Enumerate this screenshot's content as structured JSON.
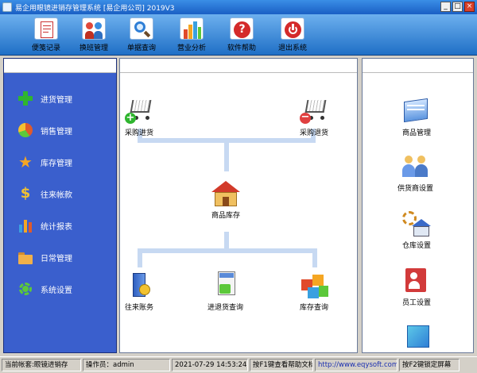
{
  "window": {
    "title": "易企用眼镜进销存管理系统 [易企用公司] 2019V3",
    "controls": [
      "_",
      "□",
      "×"
    ]
  },
  "toolbar": [
    {
      "label": "便笺记录",
      "icon": "notepad-icon"
    },
    {
      "label": "换班管理",
      "icon": "shift-change-icon"
    },
    {
      "label": "单据查询",
      "icon": "search-icon"
    },
    {
      "label": "营业分析",
      "icon": "bar-chart-icon"
    },
    {
      "label": "软件帮助",
      "icon": "help-icon"
    },
    {
      "label": "退出系统",
      "icon": "power-icon"
    }
  ],
  "sidebar": [
    {
      "label": "进货管理",
      "icon": "plus-icon",
      "color": "#2fb52f"
    },
    {
      "label": "销售管理",
      "icon": "pie-chart-icon",
      "color": "#e05a2a"
    },
    {
      "label": "库存管理",
      "icon": "star-icon",
      "color": "#f5a623"
    },
    {
      "label": "往来帐款",
      "icon": "dollar-icon",
      "color": "#f2c230"
    },
    {
      "label": "统计报表",
      "icon": "bar-chart-icon",
      "color": "#f5a623"
    },
    {
      "label": "日常管理",
      "icon": "folder-icon",
      "color": "#e8a040"
    },
    {
      "label": "系统设置",
      "icon": "gear-icon",
      "color": "#5cc83a"
    }
  ],
  "flow": {
    "purchase_in": "采购进货",
    "purchase_return": "采购退货",
    "stock": "商品库存",
    "accounts": "往来账务",
    "io_query": "进退货查询",
    "stock_query": "库存查询"
  },
  "right_panel": [
    {
      "label": "商品管理",
      "icon": "product-icon"
    },
    {
      "label": "供货商设置",
      "icon": "supplier-icon"
    },
    {
      "label": "仓库设置",
      "icon": "warehouse-icon"
    },
    {
      "label": "员工设置",
      "icon": "staff-icon"
    }
  ],
  "status": {
    "account": "当前帐套:眼镜进销存",
    "operator": "操作员：admin",
    "datetime": "2021-07-29 14:53:24",
    "help_hint": "按F1键查看帮助文档",
    "website": "http://www.eqysoft.com/",
    "lock_hint": "按F2键锁定屏幕"
  },
  "colors": {
    "accent": "#1f6fc6",
    "sidebar_bg": "#3a5fcd",
    "pipe": "#c7d9f2"
  }
}
